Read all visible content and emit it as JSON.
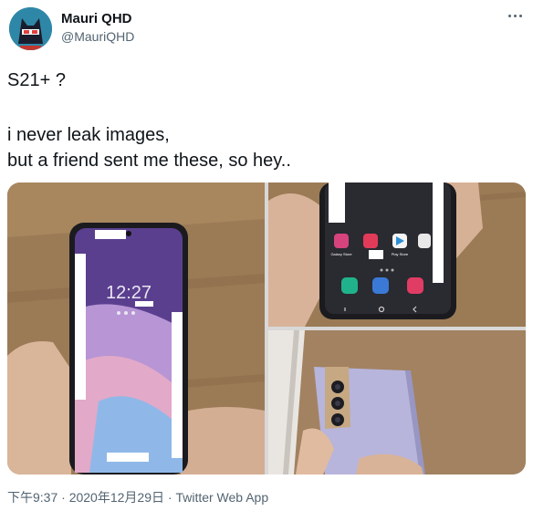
{
  "tweet": {
    "author_name": "Mauri QHD",
    "author_handle": "@MauriQHD",
    "lines": [
      "S21+ ?",
      "i never leak images,",
      "but a friend sent me these, so hey.."
    ],
    "phone_clock": "12:27",
    "timestamp": "下午9:37 · 2020年12月29日",
    "source_sep": " · ",
    "source": "Twitter Web App",
    "app_labels": [
      "Galaxy Store",
      "Play Store"
    ]
  },
  "colors": {
    "text": "#0f1419",
    "secondary": "#536471",
    "wood": "#9a7a55",
    "phone_back": "#b9b8dc"
  }
}
